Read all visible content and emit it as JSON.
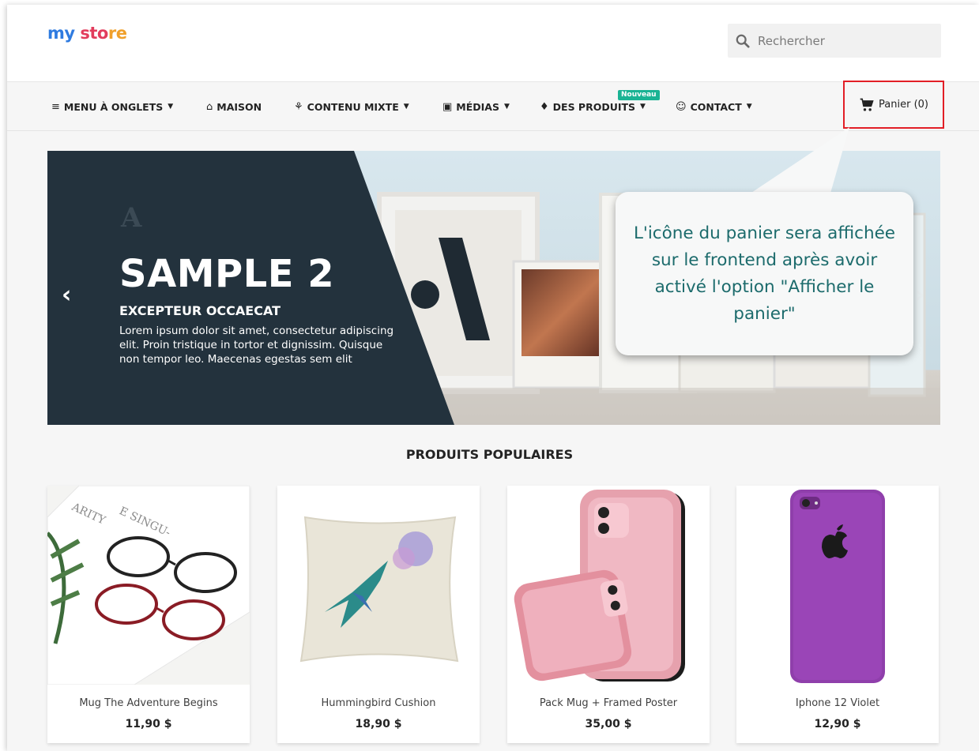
{
  "header": {
    "logo": {
      "part1": "my",
      "part2": " sto",
      "part3": "re"
    },
    "search_placeholder": "Rechercher"
  },
  "nav": {
    "items": [
      {
        "icon": "≡",
        "label": "MENU À ONGLETS",
        "caret": "▼"
      },
      {
        "icon": "⌂",
        "label": "MAISON",
        "caret": ""
      },
      {
        "icon": "⚘",
        "label": "CONTENU MIXTE",
        "caret": "▼"
      },
      {
        "icon": "▣",
        "label": "MÉDIAS",
        "caret": "▼"
      },
      {
        "icon": "♦",
        "label": "DES PRODUITS",
        "caret": "▼"
      },
      {
        "icon": "☺",
        "label": "CONTACT",
        "caret": "▼"
      }
    ],
    "badge": "Nouveau",
    "cart_label": "Panier (0)"
  },
  "slider": {
    "brand_mark": "A",
    "title": "SAMPLE 2",
    "subtitle": "EXCEPTEUR OCCAECAT",
    "text": "Lorem ipsum dolor sit amet, consectetur adipiscing elit. Proin tristique in tortor et dignissim. Quisque non tempor leo. Maecenas egestas sem elit",
    "prev": "‹",
    "next": "›"
  },
  "callout": {
    "text": "L'icône du panier sera affichée sur le frontend après avoir activé l'option \"Afficher le panier\""
  },
  "section": {
    "title": "PRODUITS POPULAIRES"
  },
  "products": [
    {
      "name": "Mug The Adventure Begins",
      "price": "11,90 $"
    },
    {
      "name": "Hummingbird Cushion",
      "price": "18,90 $"
    },
    {
      "name": "Pack Mug + Framed Poster",
      "price": "35,00 $"
    },
    {
      "name": "Iphone 12 Violet",
      "price": "12,90 $"
    }
  ],
  "colors": {
    "accent_green": "#1ab394",
    "cart_highlight": "#e21e26",
    "slide_dark": "#23323d",
    "callout_text": "#1c6b6c"
  }
}
